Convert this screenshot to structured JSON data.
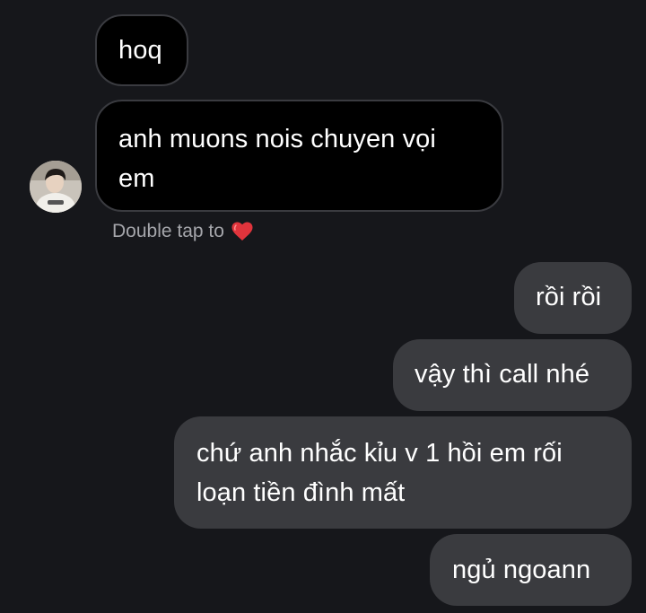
{
  "colors": {
    "background": "#16171b",
    "incoming_bubble": "#000000",
    "incoming_border": "#3a3b40",
    "outgoing_bubble": "#3a3b3f",
    "text": "#ffffff",
    "hint_text": "#a5a6ab",
    "heart": "#e0343c"
  },
  "conversation": {
    "incoming": [
      {
        "text": "hoq"
      },
      {
        "line1": "anh muons nois chuyen vọi",
        "line2": "em"
      }
    ],
    "reaction_hint": {
      "text": "Double tap to",
      "icon": "heart-icon"
    },
    "outgoing": [
      {
        "text": "rồi rồi"
      },
      {
        "text": "vậy thì call nhé"
      },
      {
        "line1": "chứ anh nhắc kỉu v 1 hồi em rối",
        "line2": "loạn tiền đình mất"
      },
      {
        "text": "ngủ ngoann"
      }
    ],
    "avatar": {
      "icon": "avatar"
    }
  }
}
